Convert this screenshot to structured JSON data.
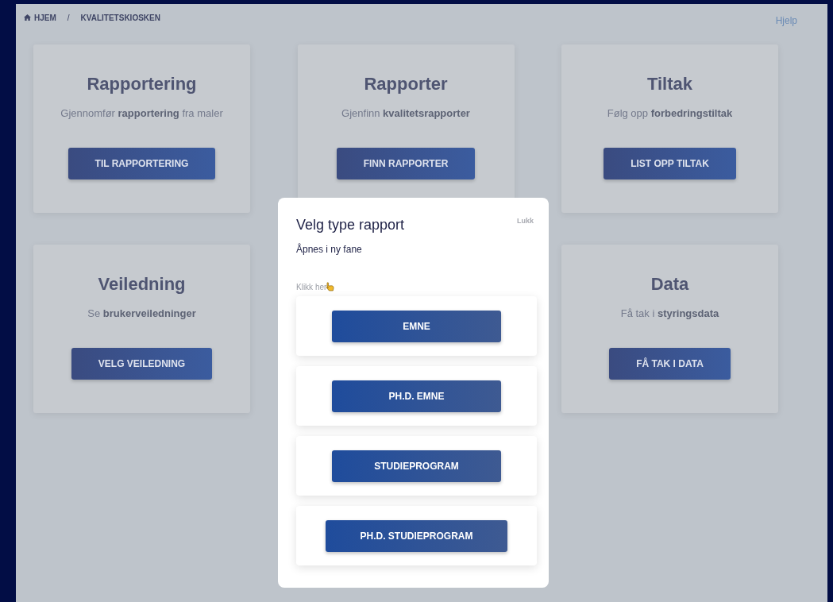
{
  "breadcrumb": {
    "items": [
      "HJEM",
      "KVALITETSKIOSKEN"
    ],
    "separator": "/"
  },
  "help_link": "Hjelp",
  "card_rows": [
    [
      {
        "title": "Rapportering",
        "description": "Gjennomfør **rapportering** fra maler",
        "button": "TIL RAPPORTERING"
      },
      {
        "title": "Rapporter",
        "description": "Gjenfinn **kvalitetsrapporter**",
        "button": "FINN RAPPORTER"
      },
      {
        "title": "Tiltak",
        "description": "Følg opp **forbedringstiltak**",
        "button": "LIST OPP TILTAK"
      }
    ],
    [
      {
        "title": "Veiledning",
        "description": "Se **brukerveiledninger**",
        "button": "VELG VEILEDNING"
      },
      {
        "title": "Data",
        "description": "Få tak i **styringsdata**",
        "button": "FÅ TAK I DATA"
      }
    ]
  ],
  "modal": {
    "title": "Velg type rapport",
    "close": "Lukk",
    "subtitle": "Åpnes i ny fane",
    "hint": "Klikk her",
    "options": [
      "EMNE",
      "PH.D. EMNE",
      "STUDIEPROGRAM",
      "PH.D. STUDIEPROGRAM"
    ]
  }
}
